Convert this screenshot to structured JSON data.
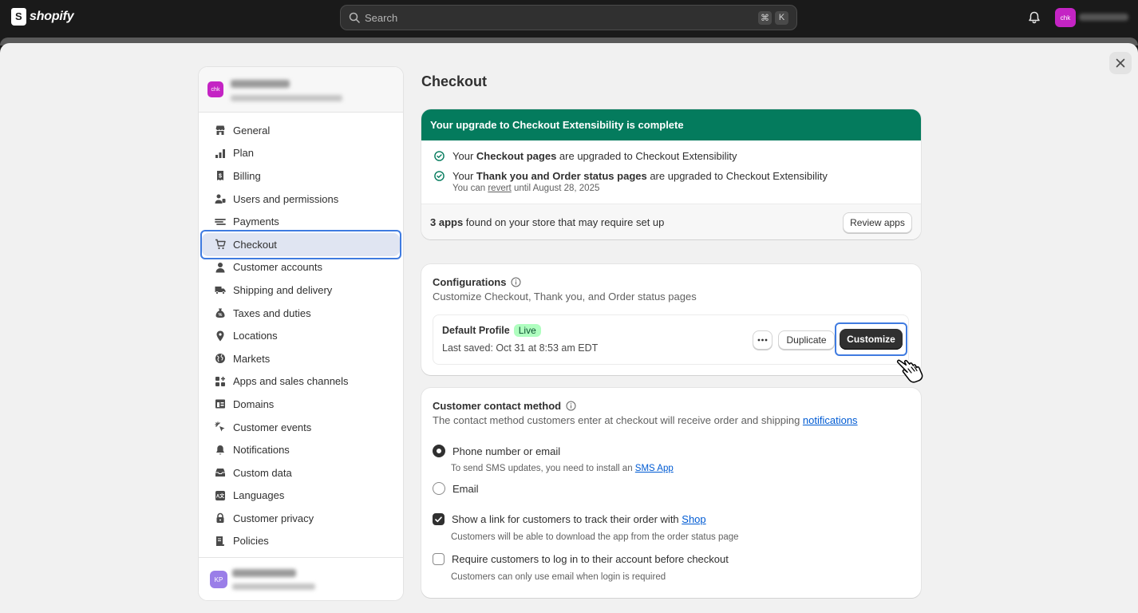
{
  "topbar": {
    "brand": "shopify",
    "search_placeholder": "Search",
    "shortcut_key1": "⌘",
    "shortcut_key2": "K",
    "store_badge": "chk"
  },
  "sidebar": {
    "store_avatar": "chk",
    "items": [
      {
        "label": "General",
        "icon": "store-icon"
      },
      {
        "label": "Plan",
        "icon": "plan-icon"
      },
      {
        "label": "Billing",
        "icon": "billing-icon"
      },
      {
        "label": "Users and permissions",
        "icon": "users-icon"
      },
      {
        "label": "Payments",
        "icon": "payments-icon"
      },
      {
        "label": "Checkout",
        "icon": "cart-icon",
        "active": true
      },
      {
        "label": "Customer accounts",
        "icon": "person-icon"
      },
      {
        "label": "Shipping and delivery",
        "icon": "truck-icon"
      },
      {
        "label": "Taxes and duties",
        "icon": "tax-icon"
      },
      {
        "label": "Locations",
        "icon": "location-icon"
      },
      {
        "label": "Markets",
        "icon": "globe-icon"
      },
      {
        "label": "Apps and sales channels",
        "icon": "apps-icon"
      },
      {
        "label": "Domains",
        "icon": "domains-icon"
      },
      {
        "label": "Customer events",
        "icon": "cursor-icon"
      },
      {
        "label": "Notifications",
        "icon": "bell-icon"
      },
      {
        "label": "Custom data",
        "icon": "data-icon"
      },
      {
        "label": "Languages",
        "icon": "languages-icon"
      },
      {
        "label": "Customer privacy",
        "icon": "lock-icon"
      },
      {
        "label": "Policies",
        "icon": "policies-icon"
      }
    ],
    "user_initials": "KP"
  },
  "main": {
    "title": "Checkout",
    "upgrade": {
      "banner": "Your upgrade to Checkout Extensibility is complete",
      "line1_pre": "Your ",
      "line1_bold": "Checkout pages",
      "line1_post": " are upgraded to Checkout Extensibility",
      "line2_pre": "Your ",
      "line2_bold": "Thank you and Order status pages",
      "line2_post": " are upgraded to Checkout Extensibility",
      "revert_pre": "You can ",
      "revert_link": "revert",
      "revert_post": " until August 28, 2025",
      "apps_bold": "3 apps",
      "apps_text": " found on your store that may require set up",
      "review_button": "Review apps"
    },
    "configurations": {
      "title": "Configurations",
      "subtitle": "Customize Checkout, Thank you, and Order status pages",
      "profile_name": "Default Profile",
      "live_badge": "Live",
      "last_saved": "Last saved: Oct 31 at 8:53 am EDT",
      "duplicate_button": "Duplicate",
      "customize_button": "Customize"
    },
    "contact": {
      "title": "Customer contact method",
      "subtitle_pre": "The contact method customers enter at checkout will receive order and shipping ",
      "subtitle_link": "notifications",
      "opt_phone": "Phone number or email",
      "opt_phone_help_pre": "To send SMS updates, you need to install an ",
      "opt_phone_help_link": "SMS App",
      "opt_email": "Email",
      "shop_link_pre": "Show a link for customers to track their order with ",
      "shop_link": "Shop",
      "shop_help": "Customers will be able to download the app from the order status page",
      "login_label": "Require customers to log in to their account before checkout",
      "login_help": "Customers can only use email when login is required",
      "selected": "Phone number or email",
      "show_shop_link_checked": true,
      "require_login_checked": false
    }
  },
  "colors": {
    "banner_green": "#047b5d",
    "focus_blue": "#3f7be0",
    "link_blue": "#005bd3",
    "live_bg": "#affebf",
    "store_badge": "#c424c4"
  }
}
